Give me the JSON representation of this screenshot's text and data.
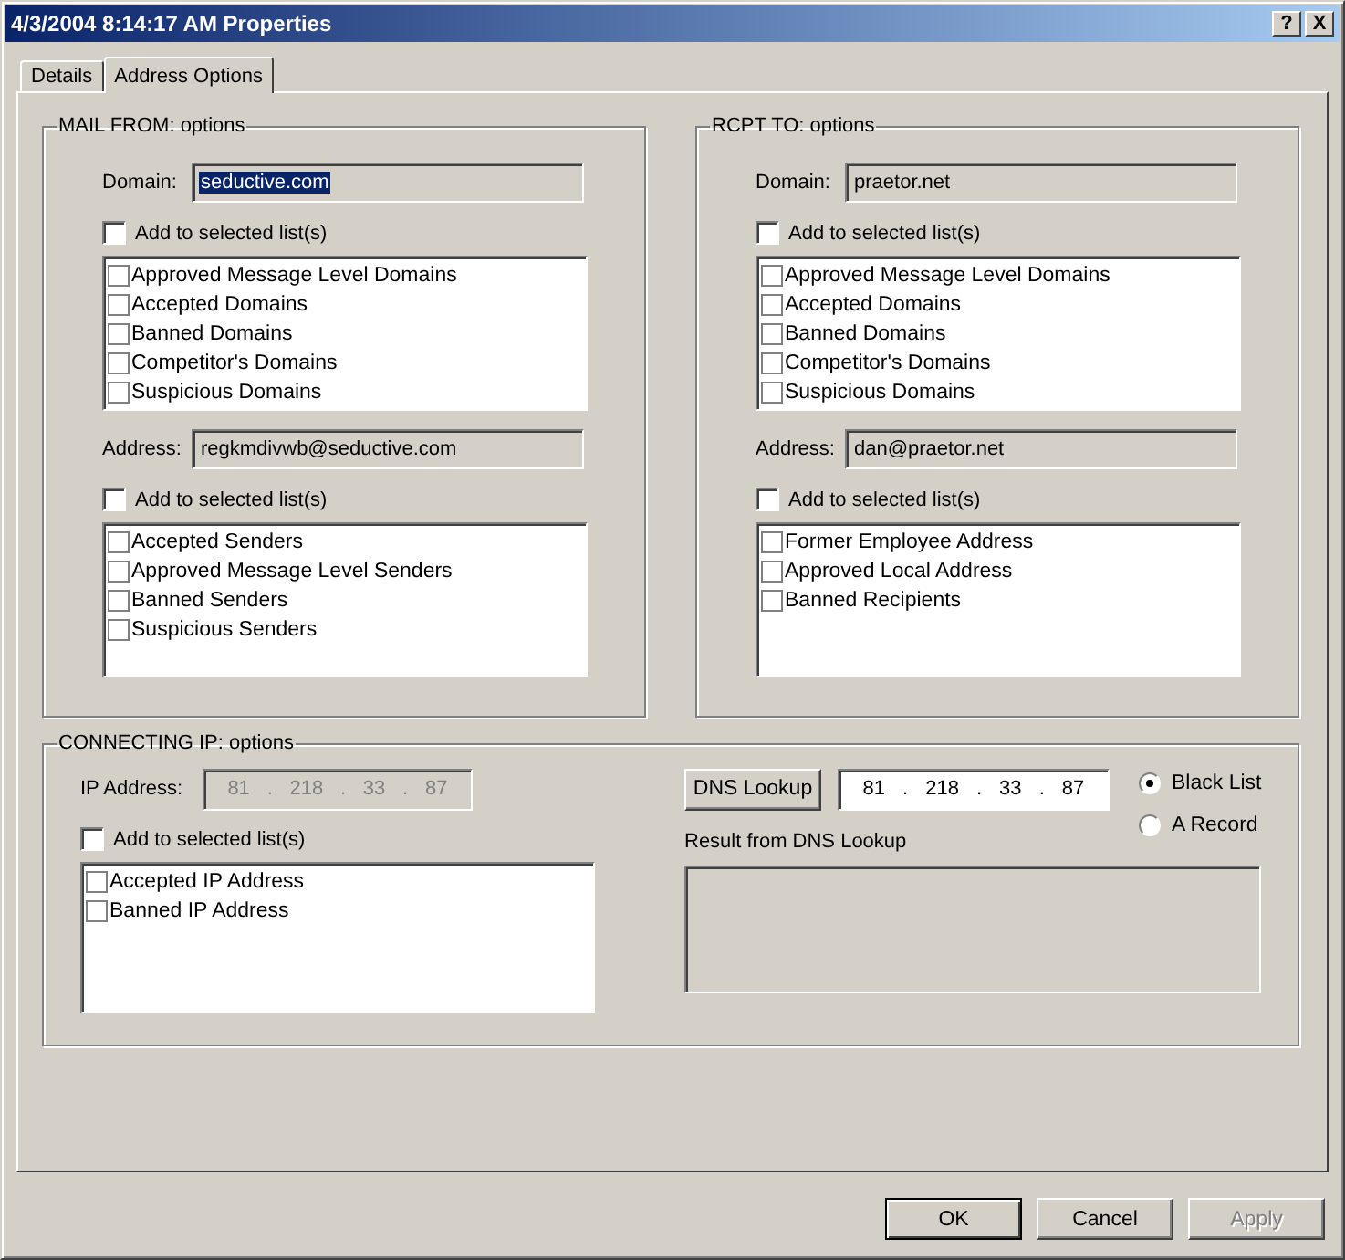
{
  "window": {
    "title": "4/3/2004 8:14:17 AM Properties",
    "title_buttons": [
      {
        "label": "?"
      },
      {
        "label": "X"
      }
    ]
  },
  "tabs": [
    {
      "label": "Details",
      "selected": false
    },
    {
      "label": "Address Options",
      "selected": true
    }
  ],
  "groups": [
    {
      "title": "MAIL FROM: options",
      "sections": [
        {
          "field": {
            "label": "Domain:",
            "value": "seductive.com",
            "text_selected": true
          },
          "add": {
            "label": "Add to selected list(s)",
            "checked": false
          },
          "lists": [
            {
              "label": "Approved Message Level Domains",
              "checked": false
            },
            {
              "label": "Accepted Domains",
              "checked": false
            },
            {
              "label": "Banned Domains",
              "checked": false
            },
            {
              "label": "Competitor's Domains",
              "checked": false
            },
            {
              "label": "Suspicious Domains",
              "checked": false
            }
          ]
        },
        {
          "field": {
            "label": "Address:",
            "value": "regkmdivwb@seductive.com",
            "text_selected": false
          },
          "add": {
            "label": "Add to selected list(s)",
            "checked": false
          },
          "lists": [
            {
              "label": "Accepted Senders",
              "checked": false
            },
            {
              "label": "Approved Message Level Senders",
              "checked": false
            },
            {
              "label": "Banned Senders",
              "checked": false
            },
            {
              "label": "Suspicious Senders",
              "checked": false
            }
          ]
        }
      ]
    },
    {
      "title": "RCPT TO: options",
      "sections": [
        {
          "field": {
            "label": "Domain:",
            "value": "praetor.net",
            "text_selected": false
          },
          "add": {
            "label": "Add to selected list(s)",
            "checked": false
          },
          "lists": [
            {
              "label": "Approved Message Level Domains",
              "checked": false
            },
            {
              "label": "Accepted Domains",
              "checked": false
            },
            {
              "label": "Banned Domains",
              "checked": false
            },
            {
              "label": "Competitor's Domains",
              "checked": false
            },
            {
              "label": "Suspicious Domains",
              "checked": false
            }
          ]
        },
        {
          "field": {
            "label": "Address:",
            "value": "dan@praetor.net",
            "text_selected": false
          },
          "add": {
            "label": "Add to selected list(s)",
            "checked": false
          },
          "lists": [
            {
              "label": "Former Employee Address",
              "checked": false
            },
            {
              "label": "Approved Local Address",
              "checked": false
            },
            {
              "label": "Banned Recipients",
              "checked": false
            }
          ]
        }
      ]
    }
  ],
  "connecting_ip": {
    "title": "CONNECTING IP: options",
    "ip_address": {
      "label": "IP Address:",
      "octets": [
        "81",
        "218",
        "33",
        "87"
      ],
      "separators": [
        ".",
        ".",
        "."
      ],
      "disabled": true
    },
    "add": {
      "label": "Add to selected list(s)",
      "checked": false
    },
    "lists": [
      {
        "label": "Accepted IP Address",
        "checked": false
      },
      {
        "label": "Banned IP Address",
        "checked": false
      }
    ],
    "dns_button": "DNS Lookup",
    "dns_ip": {
      "octets": [
        "81",
        "218",
        "33",
        "87"
      ],
      "separators": [
        ".",
        ".",
        "."
      ],
      "disabled": false
    },
    "record_types": [
      {
        "label": "Black List",
        "selected": true
      },
      {
        "label": "A Record",
        "selected": false
      }
    ],
    "result": {
      "label": "Result from DNS Lookup"
    }
  },
  "buttons": [
    {
      "label": "OK",
      "default": true,
      "disabled": false
    },
    {
      "label": "Cancel",
      "default": false,
      "disabled": false
    },
    {
      "label": "Apply",
      "default": false,
      "disabled": true
    }
  ]
}
